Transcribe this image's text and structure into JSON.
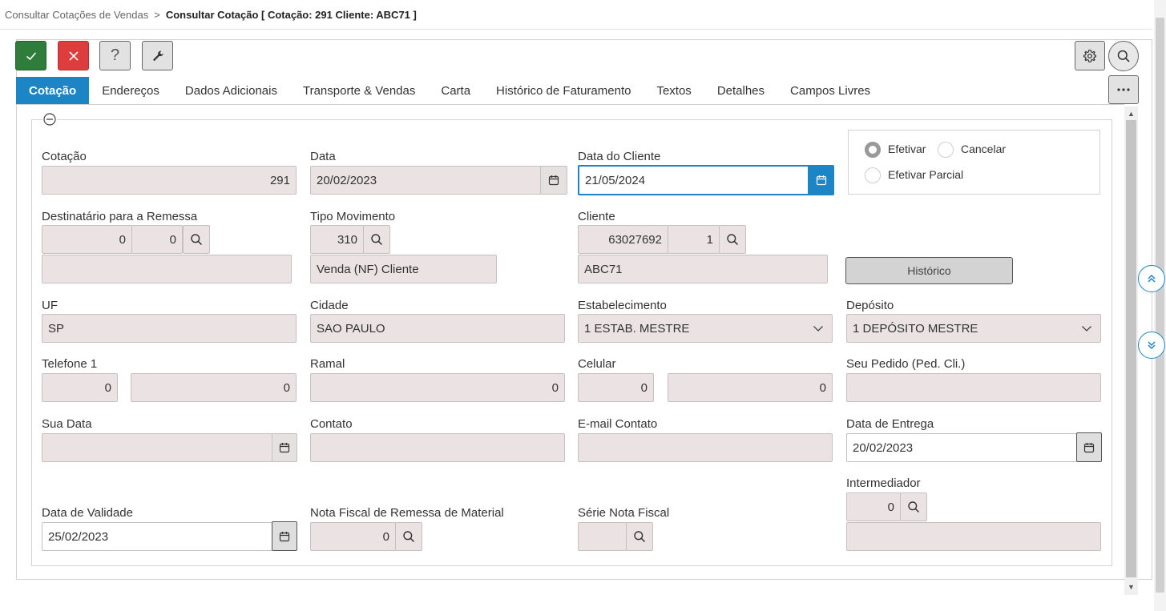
{
  "breadcrumb": {
    "parent": "Consultar Cotações de Vendas",
    "separator": ">",
    "current": "Consultar Cotação [ Cotação: 291 Cliente: ABC71 ]"
  },
  "toolbar": {
    "confirm_icon": "check-icon",
    "cancel_icon": "close-icon",
    "help_label": "?",
    "tools_icon": "wrench-icon",
    "settings_icon": "gear-icon",
    "search_icon": "search-icon"
  },
  "tabs": [
    {
      "label": "Cotação",
      "active": true
    },
    {
      "label": "Endereços"
    },
    {
      "label": "Dados Adicionais"
    },
    {
      "label": "Transporte & Vendas"
    },
    {
      "label": "Carta"
    },
    {
      "label": "Histórico de Faturamento"
    },
    {
      "label": "Textos"
    },
    {
      "label": "Detalhes"
    },
    {
      "label": "Campos Livres"
    }
  ],
  "form": {
    "cotacao": {
      "label": "Cotação",
      "value": "291"
    },
    "data": {
      "label": "Data",
      "value": "20/02/2023"
    },
    "data_cliente": {
      "label": "Data do Cliente",
      "value": "21/05/2024"
    },
    "options": {
      "efetivar": "Efetivar",
      "cancelar": "Cancelar",
      "efetivar_parcial": "Efetivar Parcial",
      "selected": "Efetivar"
    },
    "destinatario": {
      "label": "Destinatário para a Remessa",
      "code1": "0",
      "code2": "0",
      "name": ""
    },
    "tipo_movimento": {
      "label": "Tipo Movimento",
      "code": "310",
      "description": "Venda (NF) Cliente"
    },
    "cliente": {
      "label": "Cliente",
      "code": "63027692",
      "seq": "1",
      "name": "ABC71"
    },
    "historico_button": "Histórico",
    "uf": {
      "label": "UF",
      "value": "SP"
    },
    "cidade": {
      "label": "Cidade",
      "value": "SAO PAULO"
    },
    "estabelecimento": {
      "label": "Estabelecimento",
      "value": "1 ESTAB. MESTRE"
    },
    "deposito": {
      "label": "Depósito",
      "value": "1 DEPÓSITO MESTRE"
    },
    "telefone1": {
      "label": "Telefone 1",
      "ddd": "0",
      "number": "0"
    },
    "ramal": {
      "label": "Ramal",
      "value": "0"
    },
    "celular": {
      "label": "Celular",
      "ddd": "0",
      "number": "0"
    },
    "seu_pedido": {
      "label": "Seu Pedido (Ped. Cli.)",
      "value": ""
    },
    "sua_data": {
      "label": "Sua Data",
      "value": ""
    },
    "contato": {
      "label": "Contato",
      "value": ""
    },
    "email_contato": {
      "label": "E-mail Contato",
      "value": ""
    },
    "data_entrega": {
      "label": "Data de Entrega",
      "value": "20/02/2023"
    },
    "intermediador": {
      "label": "Intermediador",
      "code": "0",
      "name": ""
    },
    "data_validade": {
      "label": "Data de Validade",
      "value": "25/02/2023"
    },
    "nf_remessa": {
      "label": "Nota Fiscal de Remessa de Material",
      "value": "0"
    },
    "serie_nf": {
      "label": "Série Nota Fiscal",
      "value": ""
    }
  },
  "colors": {
    "accent": "#1c85c6",
    "confirm": "#2e7d3a",
    "danger": "#dd3d3d",
    "readonly_field": "#ebe3e3"
  }
}
